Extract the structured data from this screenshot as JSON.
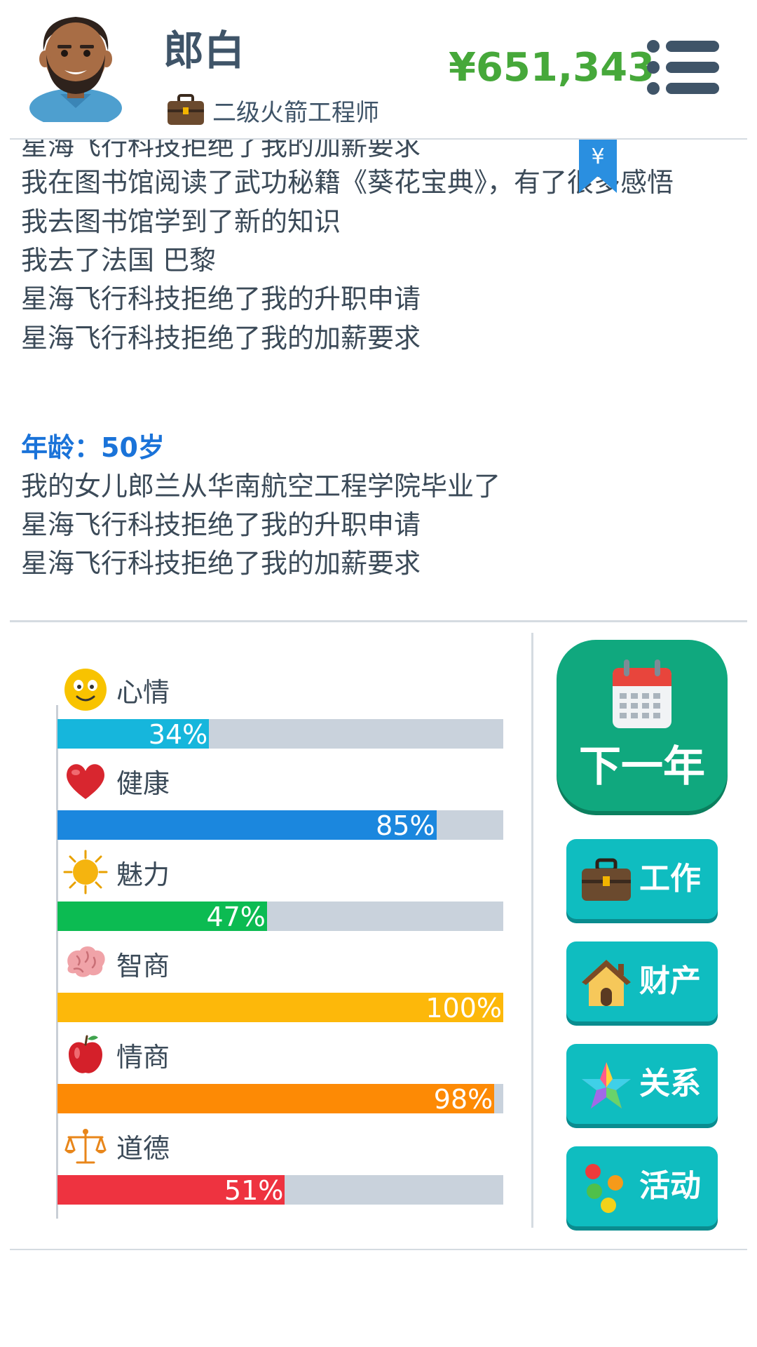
{
  "header": {
    "player_name": "郎白",
    "job_title": "二级火箭工程师",
    "money": "¥651,343",
    "job_icon": "briefcase-icon",
    "menu_icon": "menu-icon"
  },
  "log": {
    "lines_before": [
      "星海飞行科技拒绝了我的加薪要求",
      "我在图书馆阅读了武功秘籍《葵花宝典》，有了很多感悟",
      "我去图书馆学到了新的知识",
      "我去了法国 巴黎",
      "星海飞行科技拒绝了我的升职申请",
      "星海飞行科技拒绝了我的加薪要求"
    ],
    "age_label": "年龄：50岁",
    "lines_after": [
      "我的女儿郎兰从华南航空工程学院毕业了",
      "星海飞行科技拒绝了我的升职申请",
      "星海飞行科技拒绝了我的加薪要求"
    ],
    "bookmark_symbol": "¥"
  },
  "stats": [
    {
      "label": "心情",
      "value": 34,
      "value_text": "34%",
      "color": "#16b6dc",
      "icon": "smiley-icon"
    },
    {
      "label": "健康",
      "value": 85,
      "value_text": "85%",
      "color": "#1b87de",
      "icon": "heart-icon"
    },
    {
      "label": "魅力",
      "value": 47,
      "value_text": "47%",
      "color": "#0cbb52",
      "icon": "sun-icon"
    },
    {
      "label": "智商",
      "value": 100,
      "value_text": "100%",
      "color": "#fdb80a",
      "icon": "brain-icon"
    },
    {
      "label": "情商",
      "value": 98,
      "value_text": "98%",
      "color": "#fd8a05",
      "icon": "apple-icon"
    },
    {
      "label": "道德",
      "value": 51,
      "value_text": "51%",
      "color": "#ee3340",
      "icon": "scales-icon"
    }
  ],
  "actions": {
    "next_year": {
      "label": "下一年",
      "icon": "calendar-icon"
    },
    "buttons": [
      {
        "label": "工作",
        "icon": "briefcase-icon"
      },
      {
        "label": "财产",
        "icon": "house-icon"
      },
      {
        "label": "关系",
        "icon": "star-icon"
      },
      {
        "label": "活动",
        "icon": "dots-icon"
      }
    ]
  },
  "colors": {
    "money": "#46a83a",
    "age_label": "#1a73d9",
    "next_year_button": "#10a87e",
    "action_button": "#0fbdc0",
    "bar_track": "#c9d2dc"
  }
}
